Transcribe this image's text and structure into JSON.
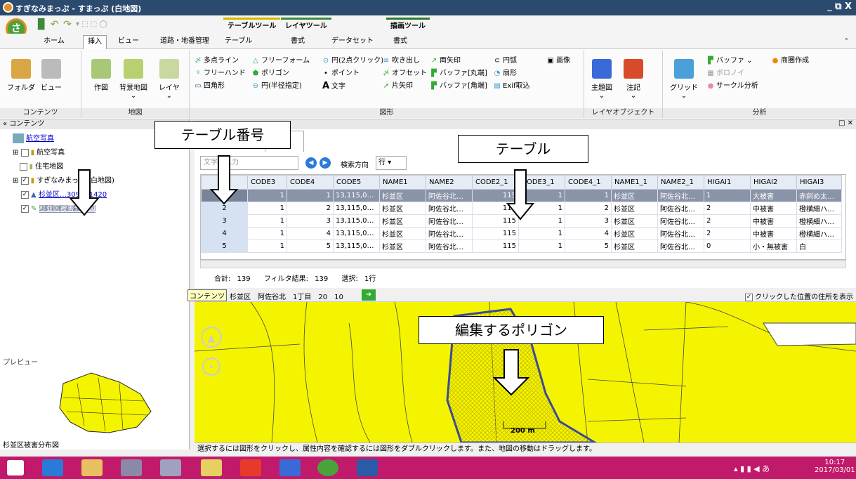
{
  "window": {
    "title": "すぎなみまっぷ - すまっぷ (白地図)",
    "controls": "_ ⧉ X"
  },
  "context_headers": [
    "テーブルツール",
    "レイヤツール",
    "描画ツール"
  ],
  "tabs": [
    "ホーム",
    "挿入",
    "ビュー",
    "道路・地番管理",
    "テーブル",
    "書式",
    "データセット",
    "書式"
  ],
  "ribbon": {
    "contents": {
      "label": "コンテンツ",
      "buttons": [
        "フォルダ",
        "ビュー"
      ]
    },
    "map": {
      "label": "地図",
      "buttons": [
        "作図",
        "背景地図",
        "レイヤ"
      ]
    },
    "shapes": {
      "label": "図形",
      "col1": [
        "多点ライン",
        "フリーハンド",
        "四角形"
      ],
      "col2": [
        "フリーフォーム",
        "ポリゴン",
        "円(半径指定)"
      ],
      "col3": [
        "円(2点クリック)",
        "ポイント",
        "文字"
      ],
      "col4": [
        "吹き出し",
        "オフセット",
        "片矢印"
      ],
      "col5": [
        "両矢印",
        "バッファ[丸端]",
        "バッファ[角端]"
      ],
      "col6": [
        "円弧",
        "扇形",
        "Exif取込"
      ],
      "col7": [
        "画像"
      ]
    },
    "layer_objects": {
      "label": "レイヤオブジェクト",
      "buttons": [
        "主題図",
        "注記"
      ]
    },
    "analysis": {
      "label": "分析",
      "buttons": [
        "グリッド"
      ],
      "small": [
        "バッファ",
        "ボロノイ",
        "サークル分析",
        "商圏作成"
      ]
    }
  },
  "left_panel": {
    "header": "コンテンツ",
    "tree": [
      {
        "label": "航空写真",
        "link": true
      },
      {
        "label": "航空写真"
      },
      {
        "label": "住宅地図"
      },
      {
        "label": "すぎなみまっぷ (白地図)"
      },
      {
        "label": "杉並区…309281420",
        "link": true
      },
      {
        "label": "杉並区被害分布図",
        "selected": true
      }
    ],
    "preview_label": "プレビュー",
    "preview_caption": "杉並区被害分布図"
  },
  "table": {
    "search_placeholder": "文字を入力",
    "search_direction_label": "検索方向",
    "search_direction_value": "行",
    "columns": [
      "",
      "CODE3",
      "CODE4",
      "CODE5",
      "NAME1",
      "NAME2",
      "CODE2_1",
      "CODE3_1",
      "CODE4_1",
      "NAME1_1",
      "NAME2_1",
      "HIGAI1",
      "HIGAI2",
      "HIGAI3"
    ],
    "rows": [
      [
        "1",
        "1",
        "1",
        "13,115,0…",
        "杉並区",
        "阿佐谷北…",
        "115",
        "1",
        "1",
        "杉並区",
        "阿佐谷北…",
        "1",
        "大被害",
        "赤斜め太…"
      ],
      [
        "2",
        "1",
        "2",
        "13,115,0…",
        "杉並区",
        "阿佐谷北…",
        "115",
        "1",
        "2",
        "杉並区",
        "阿佐谷北…",
        "2",
        "中被害",
        "橙横細ハ…"
      ],
      [
        "3",
        "1",
        "3",
        "13,115,0…",
        "杉並区",
        "阿佐谷北…",
        "115",
        "1",
        "3",
        "杉並区",
        "阿佐谷北…",
        "2",
        "中被害",
        "橙横細ハ…"
      ],
      [
        "4",
        "1",
        "4",
        "13,115,0…",
        "杉並区",
        "阿佐谷北…",
        "115",
        "1",
        "4",
        "杉並区",
        "阿佐谷北…",
        "2",
        "中被害",
        "橙横細ハ…"
      ],
      [
        "5",
        "1",
        "5",
        "13,115,0…",
        "杉並区",
        "阿佐谷北…",
        "115",
        "1",
        "5",
        "杉並区",
        "阿佐谷北…",
        "0",
        "小・無被害",
        "白"
      ]
    ],
    "footer": {
      "total": "合計: 139",
      "filtered": "フィルタ結果: 139",
      "selected": "選択: 1行"
    }
  },
  "map": {
    "address_prefix": "コンテンツ",
    "address": "杉並区　阿佐谷北　1丁目　20　10",
    "show_address_label": "クリックした位置の住所を表示",
    "scale": "200 m",
    "fill_color": "#f4f400",
    "polygon_border_color": "#3b4a9a"
  },
  "status": "選択するには図形をクリックし、属性内容を確認するには図形をダブルクリックします。また、地図の移動はドラッグします。",
  "callouts": {
    "table_number": "テーブル番号",
    "table": "テーブル",
    "polygon": "編集するポリゴン"
  },
  "clock": {
    "time": "10:17",
    "date": "2017/03/01"
  },
  "tray": "あ"
}
